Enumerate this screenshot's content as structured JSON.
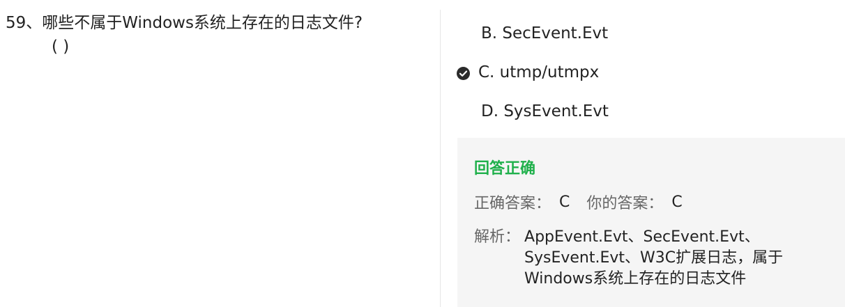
{
  "question": {
    "text": "59、哪些不属于Windows系统上存在的日志文件?",
    "paren": "( )"
  },
  "options": [
    {
      "label": "B. SecEvent.Evt",
      "selected": false
    },
    {
      "label": "C. utmp/utmpx",
      "selected": true
    },
    {
      "label": "D. SysEvent.Evt",
      "selected": false
    }
  ],
  "result": {
    "title": "回答正确",
    "title_color": "#1fb04b",
    "correct_label": "正确答案：",
    "correct_value": "C",
    "your_label": "你的答案：",
    "your_value": "C",
    "analysis_label": "解析：",
    "analysis_text": "AppEvent.Evt、SecEvent.Evt、SysEvent.Evt、W3C扩展日志，属于Windows系统上存在的日志文件"
  },
  "icons": {
    "selected_option": "check-circle-icon"
  }
}
